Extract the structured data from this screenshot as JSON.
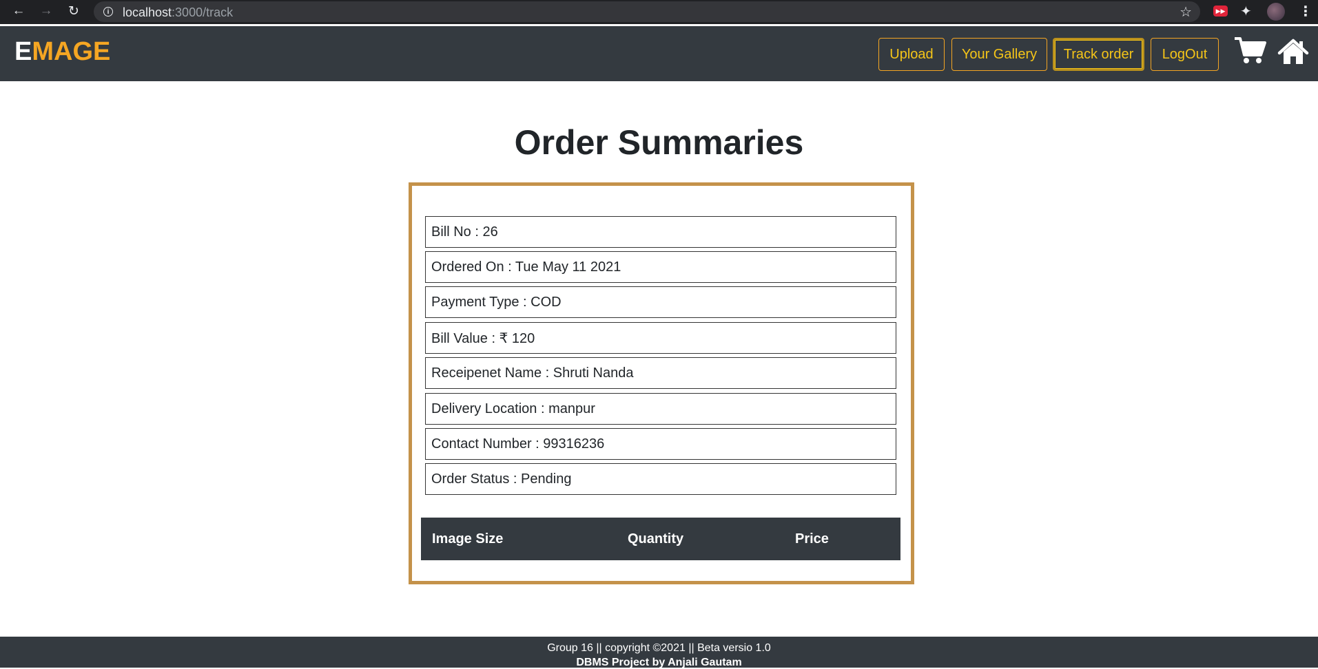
{
  "browser": {
    "url_host": "localhost",
    "url_path": ":3000/track"
  },
  "navbar": {
    "brand_first": "E",
    "brand_rest": "MAGE",
    "links": [
      {
        "label": "Upload"
      },
      {
        "label": "Your Gallery"
      },
      {
        "label": "Track order"
      },
      {
        "label": "LogOut"
      }
    ],
    "active_link": "Track order",
    "icons": [
      "cart-icon",
      "home-icon"
    ],
    "accent_color": "#f5a623"
  },
  "main": {
    "title": "Order Summaries",
    "fields": [
      {
        "text": "Bill No : 26"
      },
      {
        "text": "Ordered On : Tue May 11 2021"
      },
      {
        "text": "Payment Type : COD"
      },
      {
        "text": "Bill Value : ₹ 120"
      },
      {
        "text": "Receipenet Name : Shruti Nanda"
      },
      {
        "text": "Delivery Location : manpur"
      },
      {
        "text": "Contact Number : 99316236"
      },
      {
        "text": "Order Status : Pending"
      }
    ],
    "table_headers": [
      "Image Size",
      "Quantity",
      "Price"
    ],
    "card_border_color": "#c4924a"
  },
  "footer": {
    "line1": "Group 16 || copyright ©2021 || Beta versio 1.0",
    "line2": "DBMS Project by Anjali Gautam"
  }
}
